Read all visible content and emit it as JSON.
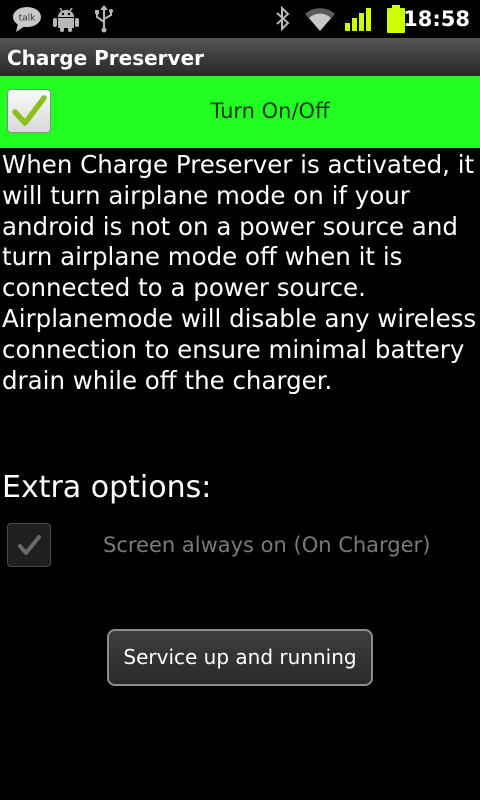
{
  "status_bar": {
    "talk_icon_label": "talk",
    "time": "18:58",
    "icons": [
      "talk-icon",
      "android-debug-icon",
      "usb-icon",
      "bluetooth-icon",
      "wifi-icon",
      "signal-icon",
      "battery-icon"
    ]
  },
  "app": {
    "title": "Charge Preserver"
  },
  "toggle": {
    "label": "Turn On/Off",
    "checked": true,
    "background_color": "#22ff22"
  },
  "description": "When Charge Preserver is activated, it will turn airplane mode on if your android is not on a power source and turn airplane mode off when it is connected to a power source. Airplanemode will disable any wireless connection to ensure minimal battery drain while off the charger.",
  "extra_options": {
    "heading": "Extra options:",
    "screen_always_on": {
      "label": "Screen always on (On Charger)",
      "checked": true,
      "enabled": false
    }
  },
  "service_button": {
    "label": "Service up and running"
  },
  "colors": {
    "background": "#000000",
    "battery": "#ccff00",
    "signal": "#ccff00",
    "check_mark": "#8bbf1a"
  }
}
